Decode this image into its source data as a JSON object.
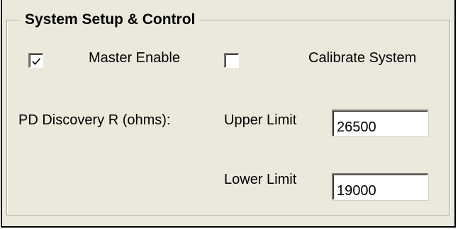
{
  "group": {
    "title": "System Setup & Control"
  },
  "master_enable": {
    "label": "Master Enable",
    "checked": true
  },
  "calibrate_system": {
    "label": "Calibrate System",
    "checked": false
  },
  "pd_discovery": {
    "label": "PD Discovery R (ohms):",
    "upper_label": "Upper Limit",
    "upper_value": "26500",
    "lower_label": "Lower Limit",
    "lower_value": "19000"
  }
}
